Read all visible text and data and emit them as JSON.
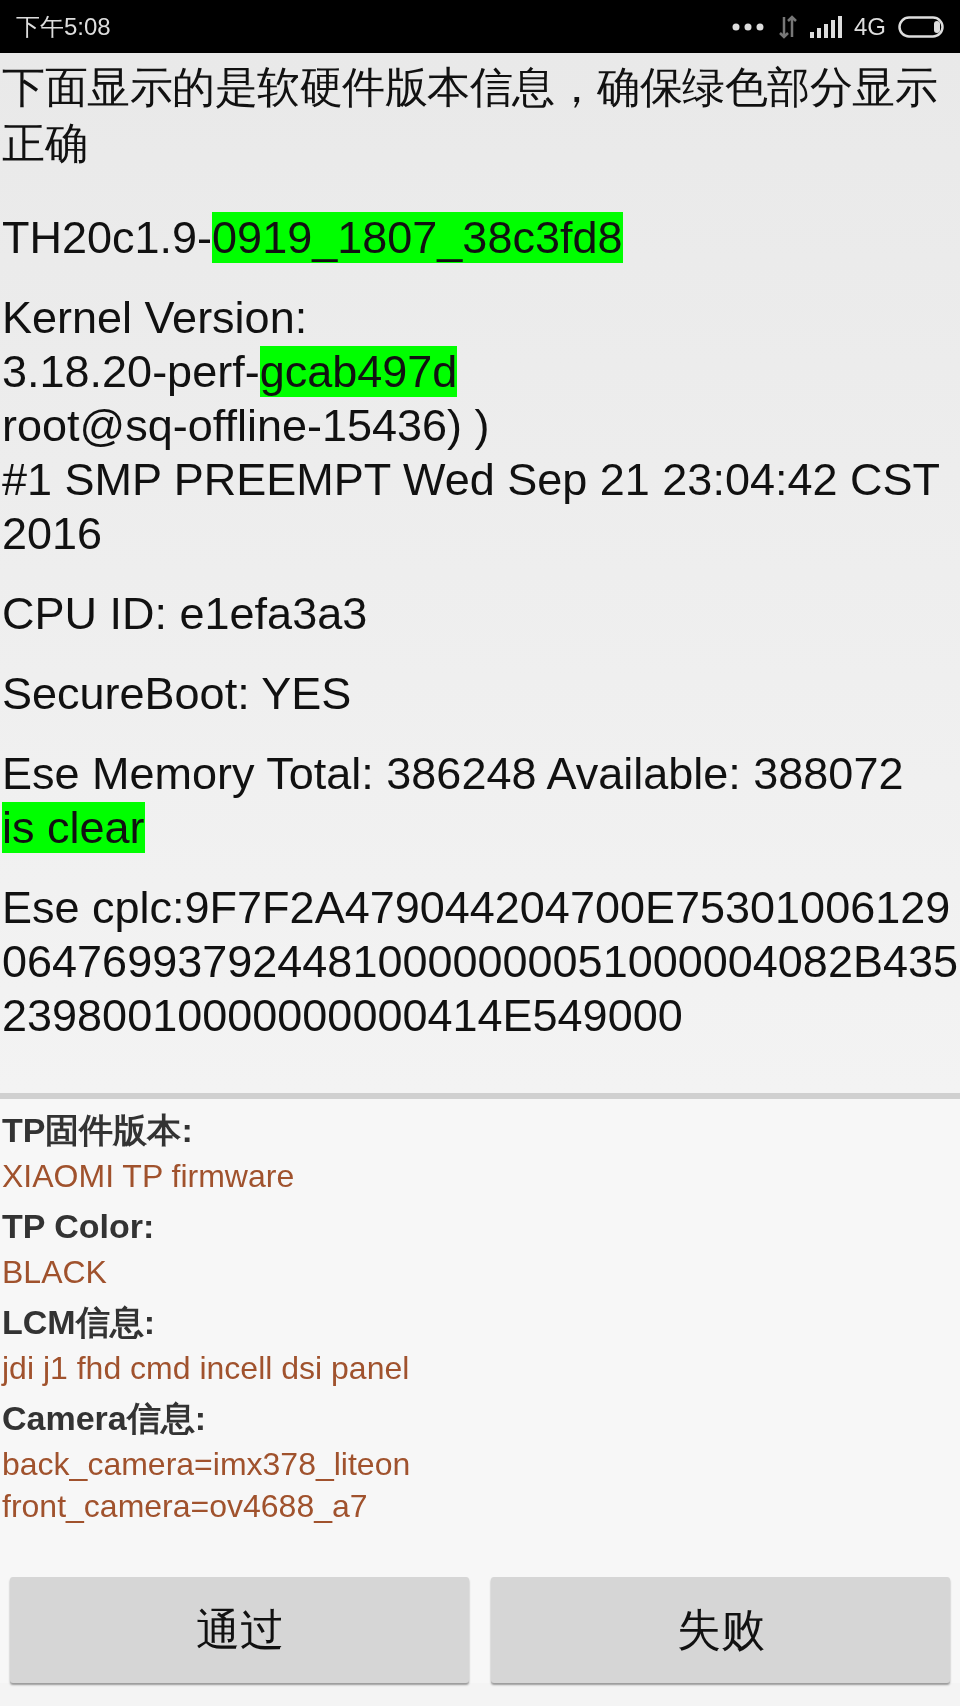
{
  "status_bar": {
    "time": "下午5:08",
    "network": "4G"
  },
  "instruction": "下面显示的是软硬件版本信息，确保绿色部分显示正确",
  "versions": [
    {
      "lines": [
        [
          {
            "text": "TH20c1.9-",
            "highlight": false
          },
          {
            "text": "0919_1807_38c3fd8",
            "highlight": true
          }
        ]
      ]
    },
    {
      "lines": [
        [
          {
            "text": "Kernel Version:",
            "highlight": false
          }
        ],
        [
          {
            "text": "3.18.20-perf-",
            "highlight": false
          },
          {
            "text": "gcab497d",
            "highlight": true
          }
        ],
        [
          {
            "text": "root@sq-offline-15436) )",
            "highlight": false
          }
        ],
        [
          {
            "text": "#1 SMP PREEMPT Wed Sep 21 23:04:42 CST 2016",
            "highlight": false
          }
        ]
      ]
    },
    {
      "lines": [
        [
          {
            "text": "CPU ID: e1efa3a3",
            "highlight": false
          }
        ]
      ]
    },
    {
      "lines": [
        [
          {
            "text": "SecureBoot: YES",
            "highlight": false
          }
        ]
      ]
    },
    {
      "lines": [
        [
          {
            "text": "Ese Memory Total: 386248 Available: 388072",
            "highlight": false
          },
          {
            "text": "is clear",
            "highlight": true
          }
        ]
      ]
    },
    {
      "lines": [
        [
          {
            "text": "Ese cplc:9F7F2A479044204700E753010061290647699379244810000000051000004082B43523980010000000000414E549000",
            "highlight": false
          }
        ]
      ]
    }
  ],
  "hardware_info": [
    {
      "label": "TP固件版本:",
      "values": [
        "XIAOMI TP firmware"
      ]
    },
    {
      "label": "TP Color:",
      "values": [
        "BLACK"
      ]
    },
    {
      "label": "LCM信息:",
      "values": [
        "jdi j1 fhd cmd incell dsi panel"
      ]
    },
    {
      "label": "Camera信息:",
      "values": [
        "back_camera=imx378_liteon",
        "front_camera=ov4688_a7"
      ]
    }
  ],
  "buttons": [
    "通过",
    "失败"
  ]
}
